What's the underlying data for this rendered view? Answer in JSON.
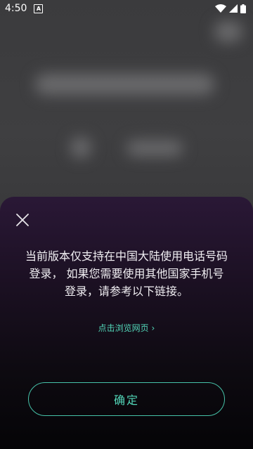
{
  "status_bar": {
    "time": "4:50",
    "notification_icon": "A"
  },
  "dialog": {
    "message": "当前版本仅支持在中国大陆使用电话号码登录， 如果您需要使用其他国家手机号登录，请参考以下链接。",
    "link_label": "点击浏览网页",
    "link_chevron": "›",
    "confirm_label": "确定"
  },
  "colors": {
    "accent": "#52d6b8",
    "sheet_top": "#2a1836",
    "sheet_bottom": "#050407"
  }
}
